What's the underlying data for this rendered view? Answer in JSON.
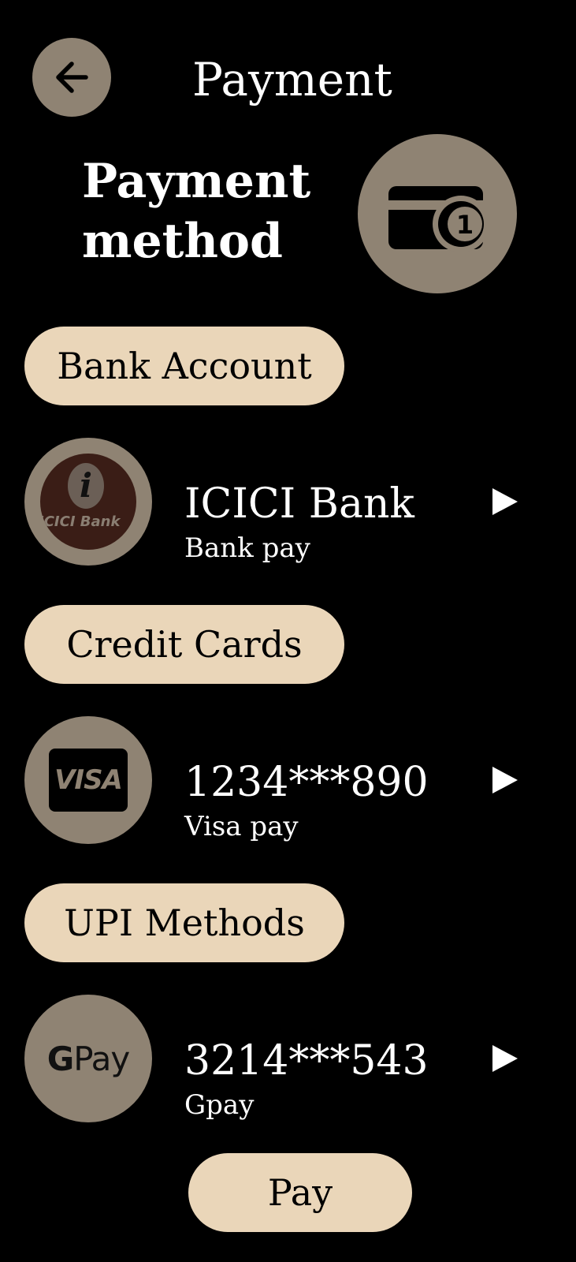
{
  "header": {
    "title": "Payment",
    "back_icon": "arrow-left-icon"
  },
  "section": {
    "title": "Payment method",
    "icon": "card-badge-icon",
    "badge_number": "1"
  },
  "groups": [
    {
      "label": "Bank Account",
      "item": {
        "title": "ICICI Bank",
        "subtitle": "Bank pay",
        "logo_text": "ICICI Bank",
        "logo_letter": "i"
      }
    },
    {
      "label": "Credit Cards",
      "item": {
        "title": "1234***890",
        "subtitle": "Visa pay",
        "logo_text": "VISA"
      }
    },
    {
      "label": "UPI Methods",
      "item": {
        "title": "3214***543",
        "subtitle": "Gpay",
        "logo_g": "G",
        "logo_pay": "Pay"
      }
    }
  ],
  "pay_button": "Pay",
  "colors": {
    "background": "#000000",
    "circle": "#8f8373",
    "pill": "#ead6b9",
    "text": "#ffffff"
  }
}
